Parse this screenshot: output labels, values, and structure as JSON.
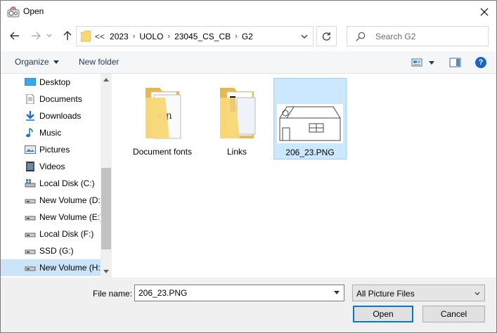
{
  "window": {
    "title": "Open"
  },
  "address": {
    "overflow": "<<",
    "crumbs": [
      "2023",
      "UOLO",
      "23045_CS_CB",
      "G2"
    ]
  },
  "search": {
    "placeholder": "Search G2"
  },
  "toolbar": {
    "organize": "Organize",
    "new_folder": "New folder",
    "help": "?"
  },
  "nav": {
    "items": [
      {
        "label": "Desktop",
        "icon": "desktop-icon"
      },
      {
        "label": "Documents",
        "icon": "documents-icon"
      },
      {
        "label": "Downloads",
        "icon": "downloads-icon"
      },
      {
        "label": "Music",
        "icon": "music-icon"
      },
      {
        "label": "Pictures",
        "icon": "pictures-icon"
      },
      {
        "label": "Videos",
        "icon": "videos-icon"
      },
      {
        "label": "Local Disk (C:)",
        "icon": "windows-drive-icon"
      },
      {
        "label": "New Volume (D:)",
        "icon": "drive-icon"
      },
      {
        "label": "New Volume (E:)",
        "icon": "drive-icon"
      },
      {
        "label": "Local Disk (F:)",
        "icon": "drive-icon"
      },
      {
        "label": "SSD (G:)",
        "icon": "drive-icon"
      },
      {
        "label": "New Volume (H:)",
        "icon": "drive-icon",
        "selected": true
      }
    ]
  },
  "files": [
    {
      "name": "Document fonts",
      "type": "folder"
    },
    {
      "name": "Links",
      "type": "folder"
    },
    {
      "name": "206_23.PNG",
      "type": "image",
      "selected": true
    }
  ],
  "bottom": {
    "file_name_label": "File name:",
    "file_name_value": "206_23.PNG",
    "file_type": "All Picture Files",
    "open_label": "Open",
    "cancel_label": "Cancel"
  },
  "colors": {
    "selection": "#cce8ff",
    "accent": "#0078d7",
    "folder": "#f8d775"
  }
}
